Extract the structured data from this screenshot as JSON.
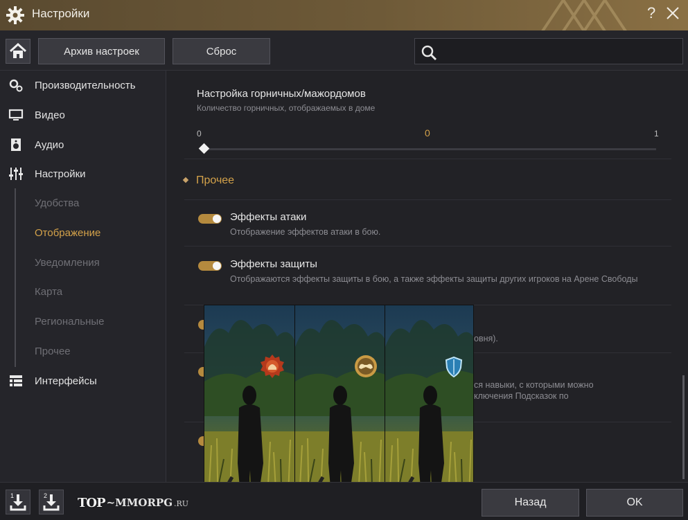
{
  "window": {
    "title": "Настройки",
    "help_glyph": "?",
    "icons": {
      "title": "gear-icon",
      "close": "close-icon"
    }
  },
  "toolbar": {
    "archive_label": "Архив настроек",
    "reset_label": "Сброс",
    "search_placeholder": ""
  },
  "sidebar": {
    "items": [
      {
        "label": "Производительность",
        "icon": "gears-icon"
      },
      {
        "label": "Видео",
        "icon": "monitor-icon"
      },
      {
        "label": "Аудио",
        "icon": "speaker-icon"
      },
      {
        "label": "Настройки",
        "icon": "sliders-icon"
      },
      {
        "label": "Интерфейсы",
        "icon": "list-icon"
      }
    ],
    "sub_items": [
      {
        "label": "Удобства",
        "active": false
      },
      {
        "label": "Отображение",
        "active": true
      },
      {
        "label": "Уведомления",
        "active": false
      },
      {
        "label": "Карта",
        "active": false
      },
      {
        "label": "Региональные",
        "active": false
      },
      {
        "label": "Прочее",
        "active": false
      }
    ]
  },
  "content": {
    "maids": {
      "title": "Настройка горничных/мажордомов",
      "desc": "Количество горничных, отображаемых в доме",
      "min": "0",
      "max": "1",
      "value": "0"
    },
    "group_title": "Прочее",
    "options": [
      {
        "title": "Эффекты атаки",
        "desc": "Отображение эффектов атаки в бою.",
        "enabled": true
      },
      {
        "title": "Эффекты защиты",
        "desc": "Отображаются эффекты защиты в бою, а также эффекты защиты других игроков на Арене Свободы",
        "enabled": true
      }
    ],
    "partial": {
      "line1": "овня).",
      "line2a": "ся навыки, с которыми можно",
      "line2b": "ключения Подсказок по"
    },
    "accent_color": "#d4a24a"
  },
  "footer": {
    "download1_num": "1",
    "download2_num": "2",
    "logo_top": "TOP",
    "logo_rest": "~MMORPG",
    "logo_ru": ".RU",
    "back_label": "Назад",
    "ok_label": "OK"
  }
}
